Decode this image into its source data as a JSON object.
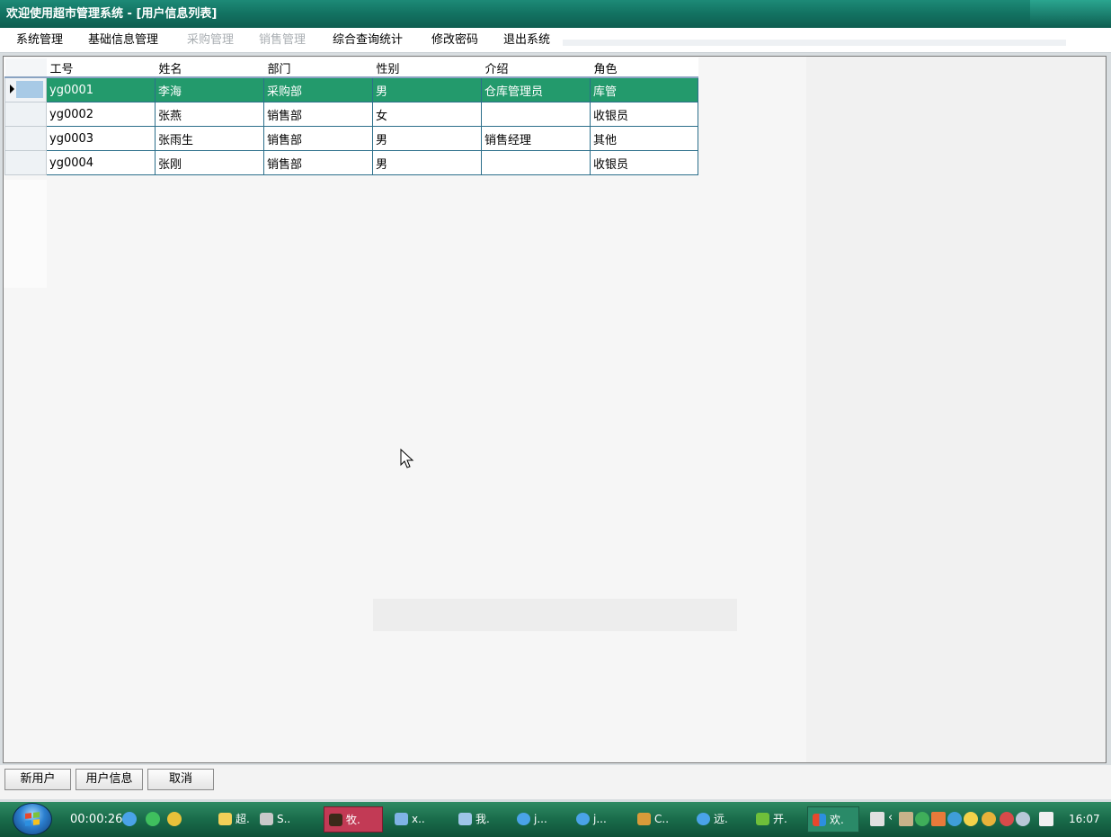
{
  "window": {
    "title": "欢迎使用超市管理系统 - [用户信息列表]"
  },
  "menu": [
    {
      "label": "系统管理",
      "enabled": true
    },
    {
      "label": "基础信息管理",
      "enabled": true
    },
    {
      "label": "采购管理",
      "enabled": false
    },
    {
      "label": "销售管理",
      "enabled": false
    },
    {
      "label": "综合查询统计",
      "enabled": true
    },
    {
      "label": "修改密码",
      "enabled": true
    },
    {
      "label": "退出系统",
      "enabled": true
    }
  ],
  "grid": {
    "columns": [
      "工号",
      "姓名",
      "部门",
      "性别",
      "介绍",
      "角色"
    ],
    "rows": [
      {
        "id": "yg0001",
        "name": "李海",
        "dept": "采购部",
        "gender": "男",
        "intro": "仓库管理员",
        "role": "库管",
        "selected": true
      },
      {
        "id": "yg0002",
        "name": "张燕",
        "dept": "销售部",
        "gender": "女",
        "intro": "",
        "role": "收银员",
        "selected": false
      },
      {
        "id": "yg0003",
        "name": "张雨生",
        "dept": "销售部",
        "gender": "男",
        "intro": "销售经理",
        "role": "其他",
        "selected": false
      },
      {
        "id": "yg0004",
        "name": "张刚",
        "dept": "销售部",
        "gender": "男",
        "intro": "",
        "role": "收银员",
        "selected": false
      }
    ]
  },
  "buttons": {
    "new_user": "新用户",
    "user_info": "用户信息",
    "cancel": "取消"
  },
  "taskbar": {
    "timer": "00:00:26",
    "tasks": [
      "超.",
      "S..",
      "牧.",
      "x..",
      "我.",
      "j...",
      "j...",
      "C..",
      "远.",
      "开.",
      "欢."
    ],
    "clock": "16:07"
  },
  "colors": {
    "title_bar": "#137463",
    "selected_row": "#239a6c",
    "taskbar": "#196b4a",
    "grid_border": "#2c6f8b"
  }
}
